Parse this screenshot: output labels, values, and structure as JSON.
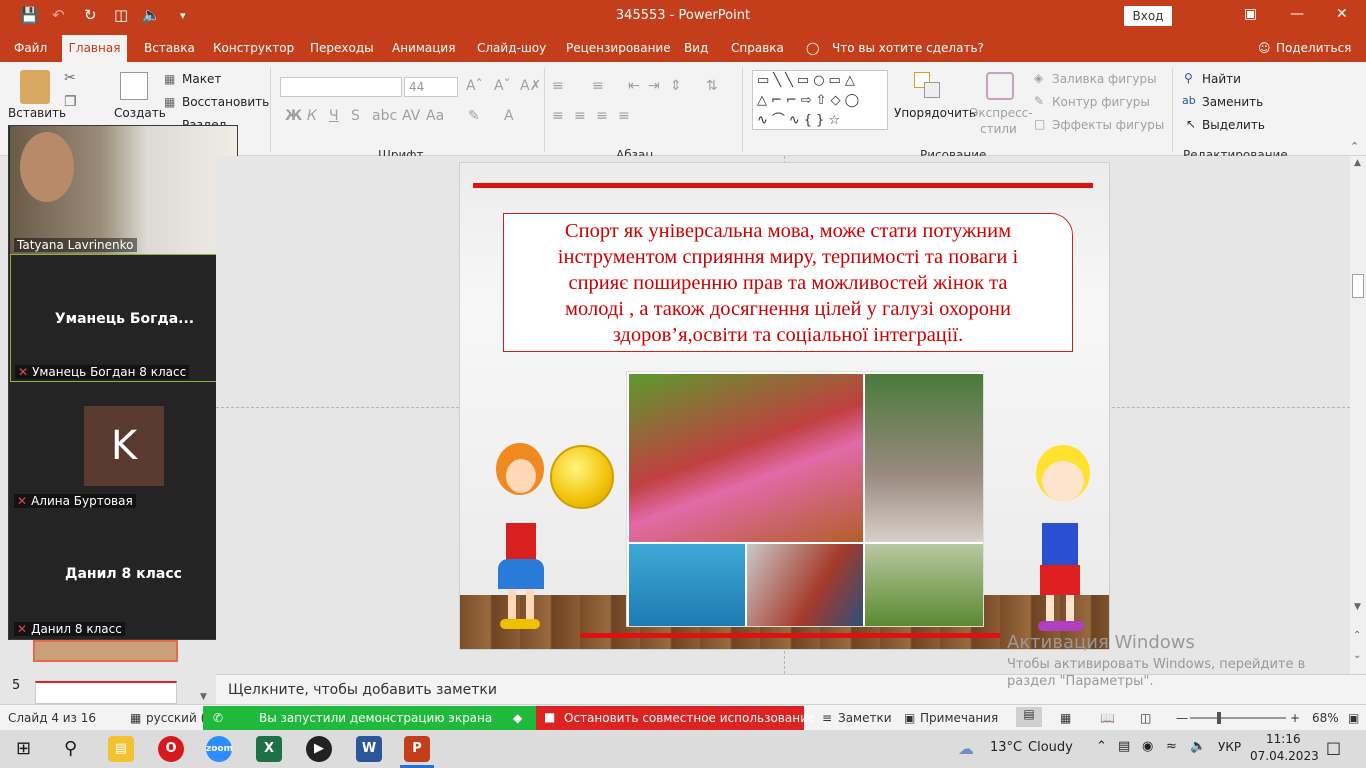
{
  "window": {
    "title": "345553  -  PowerPoint",
    "login_label": "Вход"
  },
  "menu": {
    "tabs": [
      "Файл",
      "Главная",
      "Вставка",
      "Конструктор",
      "Переходы",
      "Анимация",
      "Слайд-шоу",
      "Рецензирование",
      "Вид",
      "Справка"
    ],
    "tell_me": "Что вы хотите сделать?",
    "share": "Поделиться"
  },
  "ribbon": {
    "paste": "Вставить",
    "create": "Создать",
    "layout": "Макет",
    "restore": "Восстановить",
    "section": "Раздел",
    "font_size": "44",
    "arrange": "Упорядочить",
    "quick_styles_1": "Экспресс-",
    "quick_styles_2": "стили",
    "shape_fill": "Заливка фигуры",
    "shape_outline": "Контур фигуры",
    "shape_effects": "Эффекты фигуры",
    "find": "Найти",
    "replace": "Заменить",
    "select": "Выделить",
    "groups": {
      "font": "Шрифт",
      "paragraph": "Абзац",
      "drawing": "Рисование",
      "editing": "Редактирование"
    }
  },
  "zoom": {
    "tiles": [
      {
        "name": "Tatyana Lavrinenko",
        "label": "",
        "avatar": ""
      },
      {
        "name": "Уманець Богдан 8 класс",
        "label": "Уманець  Богда...",
        "avatar": ""
      },
      {
        "name": "Алина Буртовая",
        "label": "",
        "avatar": "K"
      },
      {
        "name": "Данил 8 класс",
        "label": "Данил 8 класс",
        "avatar": ""
      }
    ]
  },
  "thumbnails": {
    "next_number": "5"
  },
  "slide": {
    "text_lines": [
      "Спорт як універсальна мова, може стати потужним",
      "інструментом сприяння миру, терпимості та поваги і",
      "сприяє поширенню прав та можливостей жінок та",
      "молоді , а також досягнення цілей у галузі охорони",
      "здоров’я,освіти  та соціальної інтеграції."
    ],
    "accent_color": "#e01010"
  },
  "notes": {
    "placeholder": "Щелкните, чтобы добавить заметки"
  },
  "status": {
    "slide_count": "Слайд 4 из 16",
    "language": "русский (Укра",
    "share_started": "Вы запустили демонстрацию экрана",
    "stop_share": "Остановить совместное использование",
    "notes_btn": "Заметки",
    "comments_btn": "Примечания",
    "zoom_level": "68%"
  },
  "activation": {
    "line1": "Активация Windows",
    "line2": "Чтобы активировать Windows, перейдите в",
    "line3": "раздел \"Параметры\"."
  },
  "taskbar": {
    "weather_temp": "13°C",
    "weather_desc": "Cloudy",
    "lang": "УКР",
    "time": "11:16",
    "date": "07.04.2023"
  }
}
